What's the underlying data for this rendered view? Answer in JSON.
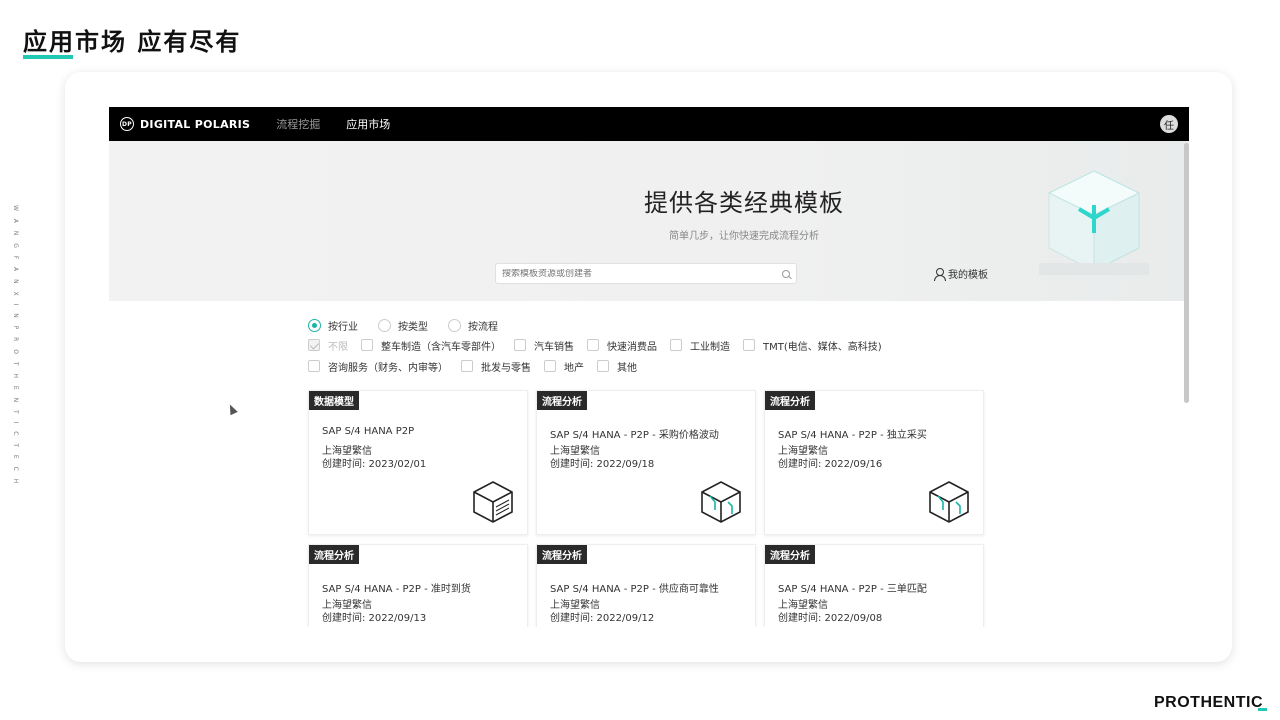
{
  "slide": {
    "title": "应用市场 应有尽有",
    "side_text": "W A N G F A N X I N   P R O T H E N T I C   T E C H",
    "footer_logo": "PROTHENTIC",
    "accent_color": "#22c8b4"
  },
  "app": {
    "brand": "DIGITAL POLARIS",
    "brand_logo": "DP",
    "nav": [
      {
        "label": "流程挖掘",
        "active": false
      },
      {
        "label": "应用市场",
        "active": true
      }
    ],
    "avatar": "任"
  },
  "banner": {
    "title": "提供各类经典模板",
    "subtitle": "简单几步，让你快速完成流程分析",
    "search_placeholder": "搜索模板资源或创建者",
    "my_templates": "我的模板"
  },
  "filters": {
    "modes": [
      {
        "label": "按行业",
        "checked": true
      },
      {
        "label": "按类型",
        "checked": false
      },
      {
        "label": "按流程",
        "checked": false
      }
    ],
    "row1": [
      {
        "label": "不限",
        "checked": true,
        "disabled": true
      },
      {
        "label": "整车制造（含汽车零部件）",
        "checked": false
      },
      {
        "label": "汽车销售",
        "checked": false
      },
      {
        "label": "快速消费品",
        "checked": false
      },
      {
        "label": "工业制造",
        "checked": false
      },
      {
        "label": "TMT(电信、媒体、高科技)",
        "checked": false
      }
    ],
    "row2": [
      {
        "label": "咨询服务（财务、内审等）",
        "checked": false
      },
      {
        "label": "批发与零售",
        "checked": false
      },
      {
        "label": "地产",
        "checked": false
      },
      {
        "label": "其他",
        "checked": false
      }
    ]
  },
  "cards": [
    {
      "tag": "数据模型",
      "title": "SAP S/4 HANA P2P",
      "org": "上海望繁信",
      "date": "创建时间: 2023/02/01",
      "icon": "data-model-cube-icon"
    },
    {
      "tag": "流程分析",
      "title": "SAP S/4 HANA - P2P - 采购价格波动",
      "org": "上海望繁信",
      "date": "创建时间: 2022/09/18",
      "icon": "process-cube-icon"
    },
    {
      "tag": "流程分析",
      "title": "SAP S/4 HANA - P2P - 独立采买",
      "org": "上海望繁信",
      "date": "创建时间: 2022/09/16",
      "icon": "process-cube-icon"
    },
    {
      "tag": "流程分析",
      "title": "SAP S/4 HANA - P2P - 准时到货",
      "org": "上海望繁信",
      "date": "创建时间: 2022/09/13",
      "icon": "process-cube-icon"
    },
    {
      "tag": "流程分析",
      "title": "SAP S/4 HANA - P2P - 供应商可靠性",
      "org": "上海望繁信",
      "date": "创建时间: 2022/09/12",
      "icon": "process-cube-icon"
    },
    {
      "tag": "流程分析",
      "title": "SAP S/4 HANA - P2P - 三单匹配",
      "org": "上海望繁信",
      "date": "创建时间: 2022/09/08",
      "icon": "process-cube-icon"
    }
  ]
}
